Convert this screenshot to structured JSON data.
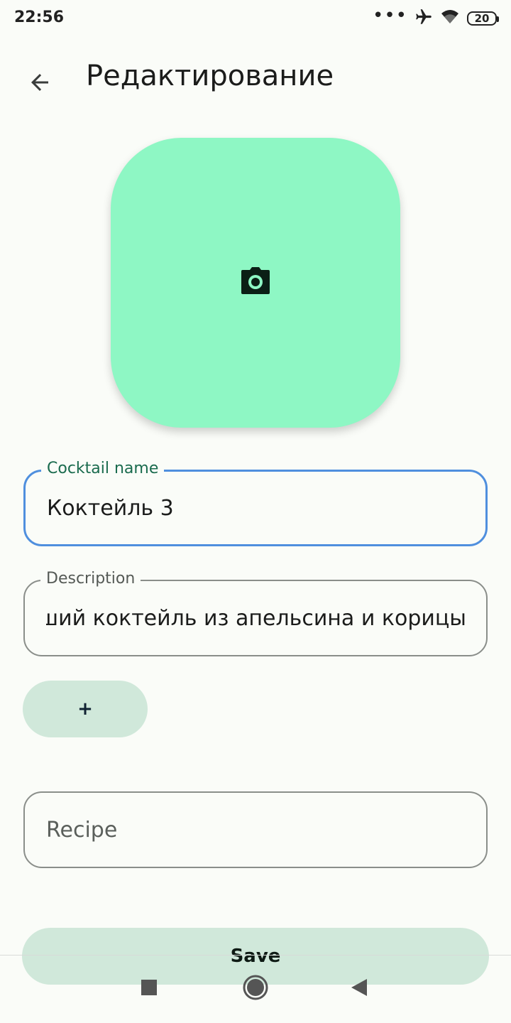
{
  "status_bar": {
    "time": "22:56",
    "dots": "•••",
    "battery": "20",
    "icons": [
      "airplane-icon",
      "wifi-icon",
      "battery-icon"
    ]
  },
  "header": {
    "title": "Редактирование",
    "back_icon": "arrow-back-icon"
  },
  "photo": {
    "icon": "camera-icon",
    "background": "#8EF7C4"
  },
  "form": {
    "cocktail_name": {
      "label": "Cocktail name",
      "value": "Коктейль 3"
    },
    "description": {
      "label": "Description",
      "value": "ший коктейль из апельсина и корицы"
    },
    "add_button_label": "+",
    "recipe": {
      "placeholder": "Recipe"
    },
    "save_label": "Save"
  },
  "navigation": {
    "items": [
      "recents-square-icon",
      "home-circle-icon",
      "back-triangle-icon"
    ]
  },
  "colors": {
    "accent": "#4F8FDE",
    "label_focused": "#1A6B4E",
    "tonal_button": "#D0E8DA",
    "background": "#FAFCF8"
  }
}
